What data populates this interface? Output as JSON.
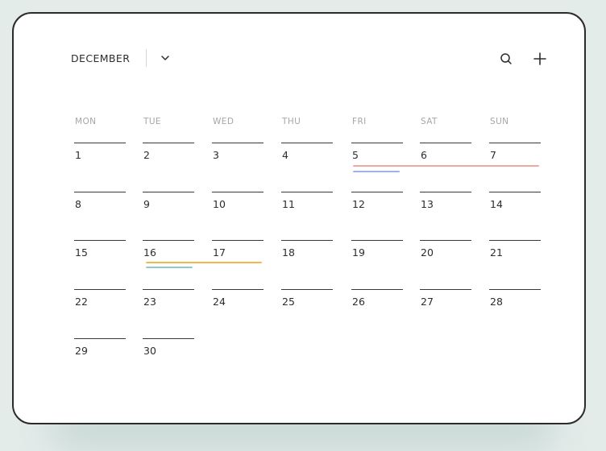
{
  "header": {
    "month": "DECEMBER"
  },
  "weekdays": [
    "MON",
    "TUE",
    "WED",
    "THU",
    "FRI",
    "SAT",
    "SUN"
  ],
  "weeks": [
    [
      "1",
      "2",
      "3",
      "4",
      "5",
      "6",
      "7"
    ],
    [
      "8",
      "9",
      "10",
      "11",
      "12",
      "13",
      "14"
    ],
    [
      "15",
      "16",
      "17",
      "18",
      "19",
      "20",
      "21"
    ],
    [
      "22",
      "23",
      "24",
      "25",
      "26",
      "27",
      "28"
    ],
    [
      "29",
      "30",
      "",
      "",
      "",
      "",
      ""
    ]
  ],
  "icons": {
    "chevron": "chevron-down-icon",
    "search": "search-icon",
    "add": "plus-icon"
  },
  "colors": {
    "event_red": "#f1a8a0",
    "event_blue": "#9fb3ea",
    "event_orange": "#f4b84a",
    "event_teal": "#8fc9d6"
  }
}
